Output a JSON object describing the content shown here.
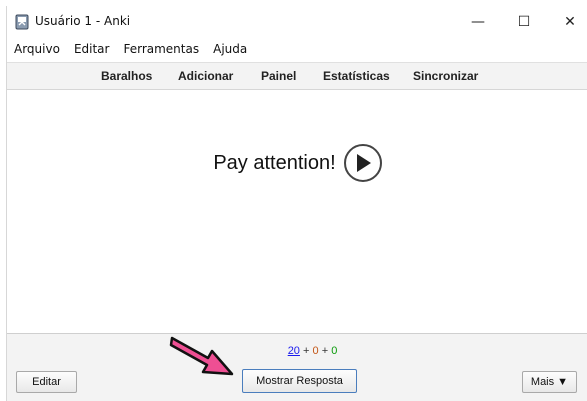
{
  "window": {
    "title": "Usuário 1 - Anki",
    "controls": {
      "minimize": "—",
      "maximize": "☐",
      "close": "✕"
    }
  },
  "menu": [
    "Arquivo",
    "Editar",
    "Ferramentas",
    "Ajuda"
  ],
  "toolbar": [
    "Baralhos",
    "Adicionar",
    "Painel",
    "Estatísticas",
    "Sincronizar"
  ],
  "card": {
    "question": "Pay attention!",
    "audio_icon": "play-icon"
  },
  "counts": {
    "new": "20",
    "learn": "0",
    "review": "0",
    "sep": "+"
  },
  "bottom": {
    "edit_label": "Editar",
    "show_answer_label": "Mostrar Resposta",
    "more_label": "Mais ▼"
  },
  "colors": {
    "annotation_arrow": "#ee4f93",
    "new_count": "#1a1aee",
    "learn_count": "#c35617",
    "review_count": "#0a9b0a"
  }
}
